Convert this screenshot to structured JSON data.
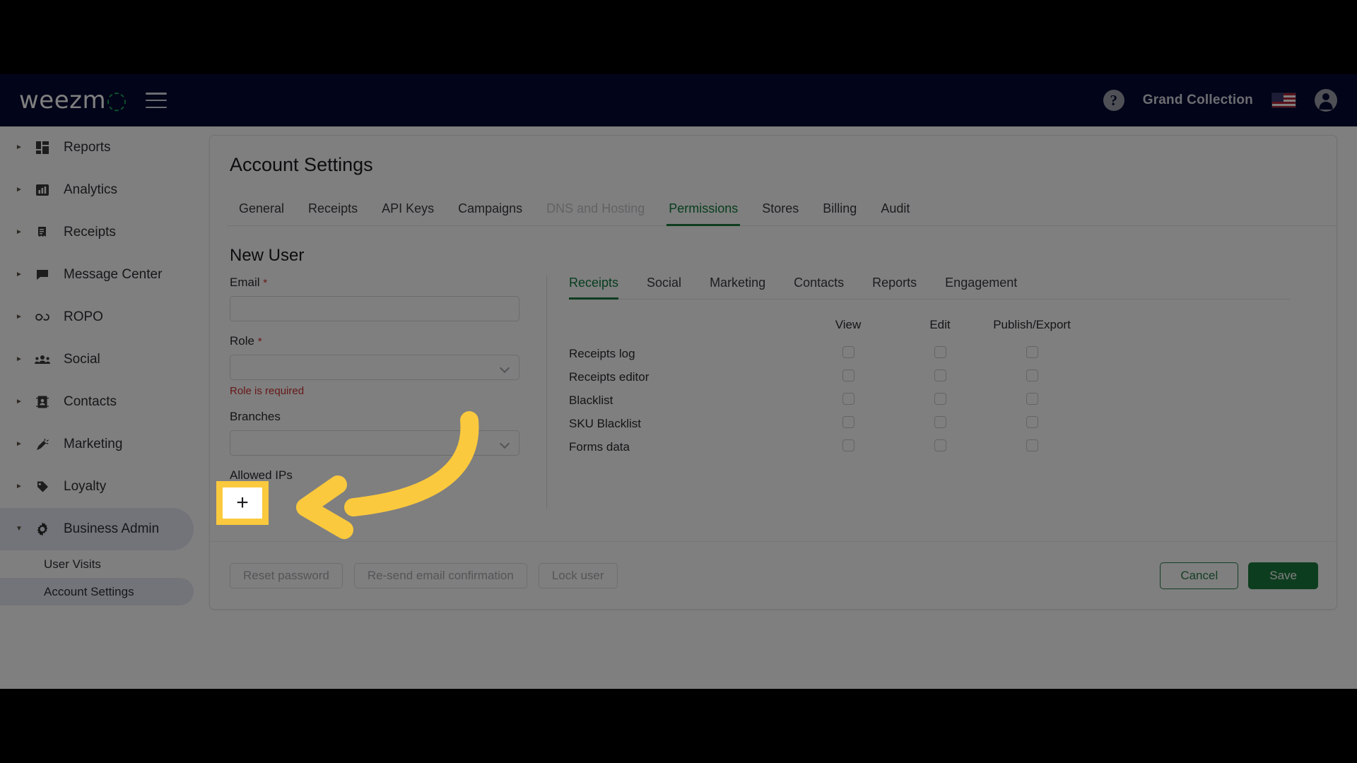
{
  "topbar": {
    "logo_main": "weezm",
    "logo_accent": "o",
    "menu_icon": "hamburger-icon",
    "help_label": "?",
    "account_name": "Grand Collection",
    "flag": "us-flag",
    "avatar": "user-avatar"
  },
  "sidebar": {
    "items": [
      {
        "label": "Reports",
        "icon": "dashboard-icon",
        "expanded": false
      },
      {
        "label": "Analytics",
        "icon": "bar-chart-icon",
        "expanded": false
      },
      {
        "label": "Receipts",
        "icon": "receipt-icon",
        "expanded": false
      },
      {
        "label": "Message Center",
        "icon": "chat-icon",
        "expanded": false
      },
      {
        "label": "ROPO",
        "icon": "infinity-icon",
        "expanded": false
      },
      {
        "label": "Social",
        "icon": "people-icon",
        "expanded": false
      },
      {
        "label": "Contacts",
        "icon": "contact-card-icon",
        "expanded": false
      },
      {
        "label": "Marketing",
        "icon": "megaphone-icon",
        "expanded": false
      },
      {
        "label": "Loyalty",
        "icon": "tag-icon",
        "expanded": false
      },
      {
        "label": "Business Admin",
        "icon": "gear-icon",
        "expanded": true
      }
    ],
    "subitems": [
      {
        "label": "User Visits",
        "active": false
      },
      {
        "label": "Account Settings",
        "active": true
      }
    ]
  },
  "page": {
    "title": "Account Settings",
    "tabs": [
      {
        "label": "General",
        "state": "normal"
      },
      {
        "label": "Receipts",
        "state": "normal"
      },
      {
        "label": "API Keys",
        "state": "normal"
      },
      {
        "label": "Campaigns",
        "state": "normal"
      },
      {
        "label": "DNS and Hosting",
        "state": "disabled"
      },
      {
        "label": "Permissions",
        "state": "active"
      },
      {
        "label": "Stores",
        "state": "normal"
      },
      {
        "label": "Billing",
        "state": "normal"
      },
      {
        "label": "Audit",
        "state": "normal"
      }
    ]
  },
  "form": {
    "heading": "New User",
    "email_label": "Email",
    "email_required_mark": "*",
    "email_value": "",
    "email_placeholder": "",
    "role_label": "Role",
    "role_required_mark": "*",
    "role_value": "",
    "role_error": "Role is required",
    "branches_label": "Branches",
    "branches_value": "",
    "allowed_ips_label": "Allowed IPs",
    "add_ip_label": "+"
  },
  "permissions": {
    "tabs": [
      {
        "label": "Receipts",
        "active": true
      },
      {
        "label": "Social",
        "active": false
      },
      {
        "label": "Marketing",
        "active": false
      },
      {
        "label": "Contacts",
        "active": false
      },
      {
        "label": "Reports",
        "active": false
      },
      {
        "label": "Engagement",
        "active": false
      }
    ],
    "columns": [
      "View",
      "Edit",
      "Publish/Export"
    ],
    "rows": [
      {
        "name": "Receipts log",
        "view": false,
        "edit": false,
        "publish": false
      },
      {
        "name": "Receipts editor",
        "view": false,
        "edit": false,
        "publish": false
      },
      {
        "name": "Blacklist",
        "view": false,
        "edit": false,
        "publish": false
      },
      {
        "name": "SKU Blacklist",
        "view": false,
        "edit": false,
        "publish": false
      },
      {
        "name": "Forms data",
        "view": false,
        "edit": false,
        "publish": false
      }
    ]
  },
  "footer": {
    "reset_password": "Reset password",
    "resend_email": "Re-send email confirmation",
    "lock_user": "Lock user",
    "cancel": "Cancel",
    "save": "Save"
  },
  "annotation": {
    "highlight_target": "add-allowed-ip-button",
    "highlight_label": "+",
    "highlight_color": "#FBC93D",
    "arrow": "curved-arrow-pointing-left"
  },
  "colors": {
    "brand_navy": "#040933",
    "brand_green": "#1A7A3E",
    "error_red": "#D03030",
    "highlight_yellow": "#FBC93D"
  }
}
